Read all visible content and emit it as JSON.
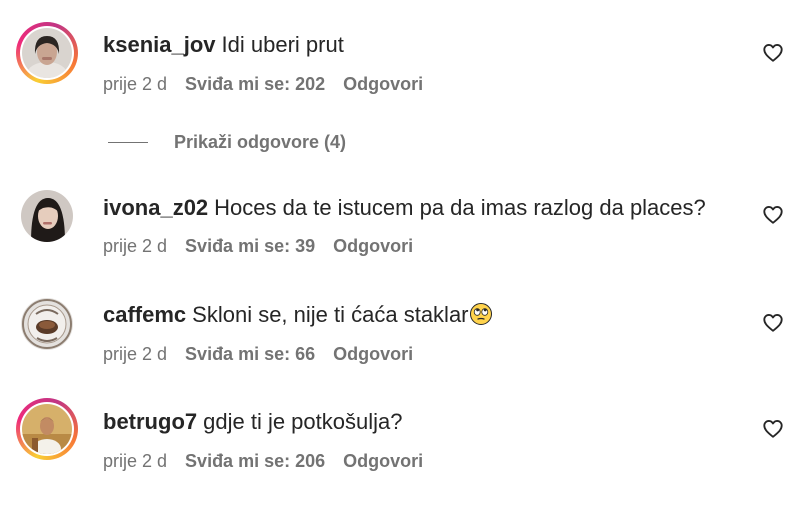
{
  "comments": [
    {
      "username": "ksenia_jov",
      "text": "Idi uberi prut",
      "time": "prije 2 d",
      "likes": "Sviđa mi se: 202",
      "reply": "Odgovori",
      "story_ring": true,
      "avatar": "woman-portrait-avatar",
      "replies": "Prikaži odgovore (4)"
    },
    {
      "username": "ivona_z02",
      "text": "Hoces da te istucem pa da imas razlog da places?",
      "time": "prije 2 d",
      "likes": "Sviđa mi se: 39",
      "reply": "Odgovori",
      "story_ring": false,
      "avatar": "woman-portrait-avatar"
    },
    {
      "username": "caffemc",
      "text": "Skloni se, nije ti ćaća staklar",
      "time": "prije 2 d",
      "likes": "Sviđa mi se: 66",
      "reply": "Odgovori",
      "story_ring": false,
      "avatar": "cafe-logo-avatar",
      "emoji": "eye-roll-emoji"
    },
    {
      "username": "betrugo7",
      "text": "gdje ti je potkošulja?",
      "time": "prije 2 d",
      "likes": "Sviđa mi se: 206",
      "reply": "Odgovori",
      "story_ring": true,
      "avatar": "man-portrait-avatar"
    }
  ],
  "icons": {
    "like": "heart-icon"
  },
  "colors": {
    "text": "#262626",
    "secondary": "#737373",
    "story_ring": "#ee2a7b"
  }
}
